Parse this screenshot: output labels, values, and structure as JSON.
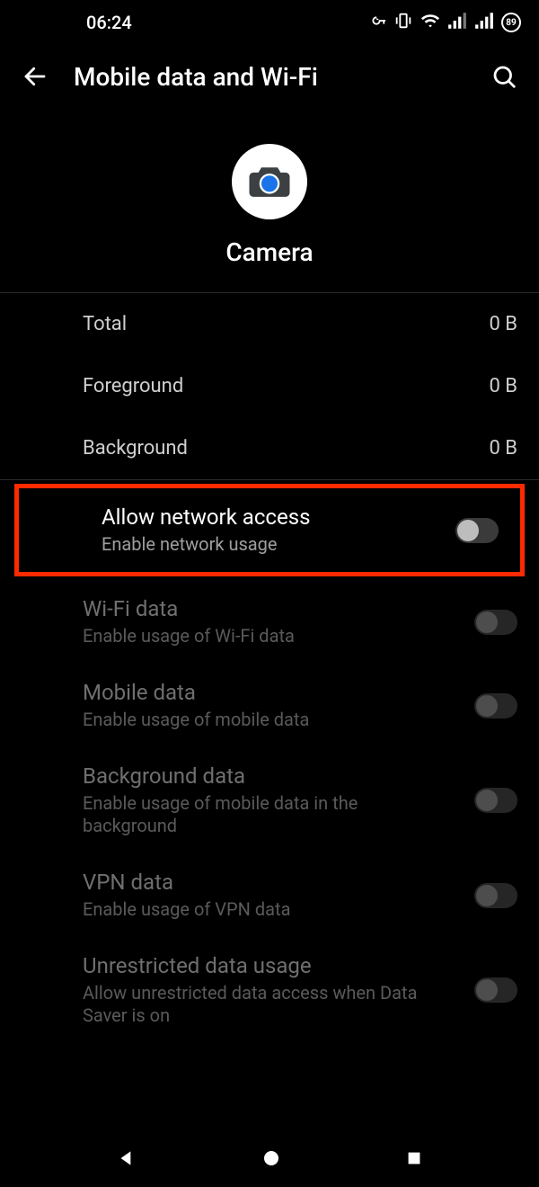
{
  "status": {
    "time": "06:24",
    "battery_label": "89"
  },
  "appbar": {
    "title": "Mobile data and Wi-Fi"
  },
  "app": {
    "name": "Camera"
  },
  "usage": {
    "total_label": "Total",
    "total_value": "0 B",
    "foreground_label": "Foreground",
    "foreground_value": "0 B",
    "background_label": "Background",
    "background_value": "0 B"
  },
  "settings": {
    "allow_network": {
      "title": "Allow network access",
      "sub": "Enable network usage",
      "on": false,
      "disabled": false
    },
    "wifi": {
      "title": "Wi-Fi data",
      "sub": "Enable usage of Wi-Fi data",
      "on": false,
      "disabled": true
    },
    "mobile": {
      "title": "Mobile data",
      "sub": "Enable usage of mobile data",
      "on": false,
      "disabled": true
    },
    "background": {
      "title": "Background data",
      "sub": "Enable usage of mobile data in the background",
      "on": false,
      "disabled": true
    },
    "vpn": {
      "title": "VPN data",
      "sub": "Enable usage of VPN data",
      "on": false,
      "disabled": true
    },
    "unrestricted": {
      "title": "Unrestricted data usage",
      "sub": "Allow unrestricted data access when Data Saver is on",
      "on": false,
      "disabled": true
    }
  }
}
